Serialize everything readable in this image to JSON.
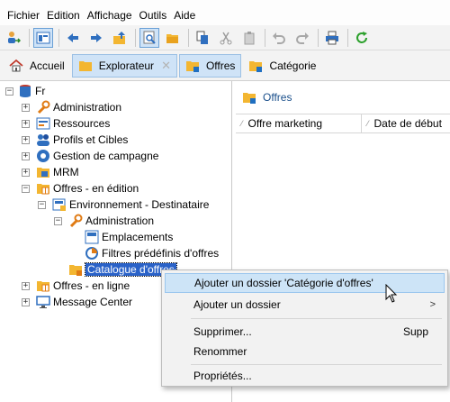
{
  "menubar": [
    "Fichier",
    "Edition",
    "Affichage",
    "Outils",
    "Aide"
  ],
  "tabs": [
    {
      "label": "Accueil"
    },
    {
      "label": "Explorateur"
    },
    {
      "label": "Offres"
    },
    {
      "label": "Catégorie"
    }
  ],
  "tree": {
    "root": "Fr",
    "items": [
      "Administration",
      "Ressources",
      "Profils et Cibles",
      "Gestion de campagne",
      "MRM",
      "Offres - en édition",
      "Environnement - Destinataire",
      "Administration",
      "Emplacements",
      "Filtres prédéfinis d'offres",
      "Catalogue d'offres",
      "Offres - en ligne",
      "Message Center"
    ]
  },
  "right_pane": {
    "title": "Offres",
    "columns": [
      "Offre marketing",
      "Date de début"
    ]
  },
  "context_menu": {
    "items": [
      {
        "label": "Ajouter un dossier 'Catégorie d'offres'"
      },
      {
        "label": "Ajouter un dossier",
        "submenu_arrow": ">"
      },
      {
        "label": "Supprimer...",
        "shortcut": "Supp"
      },
      {
        "label": "Renommer"
      },
      {
        "label": "Propriétés..."
      }
    ]
  },
  "colors": {
    "selection": "#2a62c8",
    "hover": "#cde4f7",
    "folder": "#f3b631",
    "accent_blue": "#1f6fc1",
    "refresh_green": "#2ca02c"
  }
}
